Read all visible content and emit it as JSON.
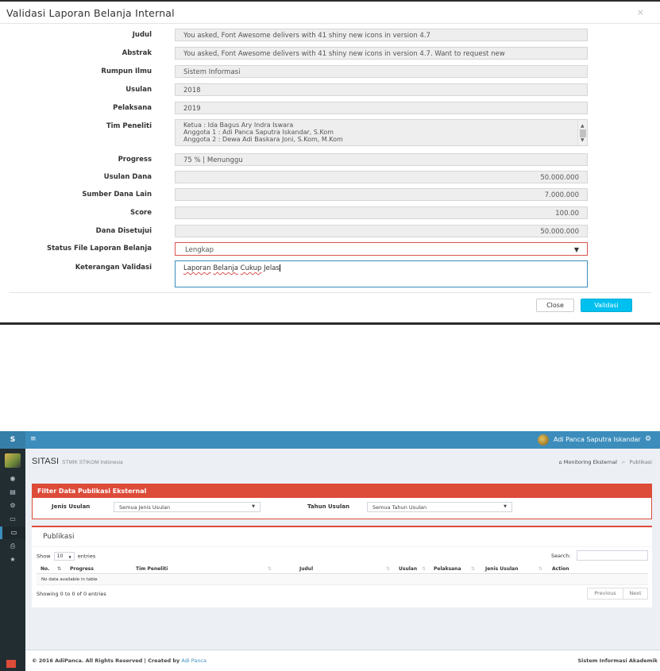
{
  "modal": {
    "title": "Validasi Laporan Belanja Internal",
    "close_icon": "×",
    "fields": {
      "judul": {
        "label": "Judul",
        "value": "You asked, Font Awesome delivers with 41 shiny new icons in version 4.7"
      },
      "abstrak": {
        "label": "Abstrak",
        "value": "You asked, Font Awesome delivers with 41 shiny new icons in version 4.7. Want to request new"
      },
      "rumpun_ilmu": {
        "label": "Rumpun Ilmu",
        "value": "Sistem Informasi"
      },
      "usulan": {
        "label": "Usulan",
        "value": "2018"
      },
      "pelaksana": {
        "label": "Pelaksana",
        "value": "2019"
      },
      "tim_peneliti": {
        "label": "Tim Peneliti",
        "lines": [
          "Ketua : Ida Bagus Ary Indra Iswara",
          "Anggota 1 : Adi Panca Saputra Iskandar, S.Kom",
          "Anggota 2 : Dewa Adi Baskara Joni, S.Kom, M.Kom"
        ]
      },
      "progress": {
        "label": "Progress",
        "value": "75 %  |  Menunggu"
      },
      "usulan_dana": {
        "label": "Usulan Dana",
        "value": "50.000.000"
      },
      "sumber_dana_lain": {
        "label": "Sumber Dana Lain",
        "value": "7.000.000"
      },
      "score": {
        "label": "Score",
        "value": "100.00"
      },
      "dana_disetujui": {
        "label": "Dana Disetujui",
        "value": "50.000.000"
      },
      "status_file": {
        "label": "Status File Laporan Belanja",
        "value": "Lengkap"
      },
      "keterangan": {
        "label": "Keterangan Validasi",
        "words": [
          "Laporan",
          "Belanja",
          "Cukup",
          "Jelas"
        ]
      }
    },
    "buttons": {
      "close": "Close",
      "validasi": "Validasi"
    }
  },
  "app": {
    "logo": "S",
    "user_name": "Adi Panca Saputra Iskandar",
    "page_title": "SITASI",
    "page_subtitle": "STMIK STIKOM Indonesia",
    "breadcrumb": {
      "home": "Monitoring Eksternal",
      "separator": ">",
      "current": "Publikasi"
    },
    "filter": {
      "title": "Filter Data Publikasi Eksternal",
      "jenis_label": "Jenis Usulan",
      "jenis_value": "Semua Jenis Usulan",
      "tahun_label": "Tahun Usulan",
      "tahun_value": "Semua Tahun Usulan"
    },
    "publikasi": {
      "title": "Publikasi",
      "show": "Show",
      "length_value": "10",
      "entries": "entries",
      "search_label": "Search:",
      "columns": [
        "No.",
        "Progress",
        "Tim Peneliti",
        "Judul",
        "Usulan",
        "Pelaksana",
        "Jenis Usulan",
        "Action"
      ],
      "empty": "No data available in table",
      "info": "Showing 0 to 0 of 0 entries",
      "prev": "Previous",
      "next": "Next"
    },
    "footer": {
      "copyright": "© 2016 AdiPanca. All Rights Reserved | Created by",
      "author": "Adi Panca",
      "right": "Sistem Informasi Akademik"
    }
  },
  "colors": {
    "primary": "#3c8dbc",
    "danger": "#dd4b39",
    "info": "#00c0ef",
    "sidebar": "#222d32"
  }
}
